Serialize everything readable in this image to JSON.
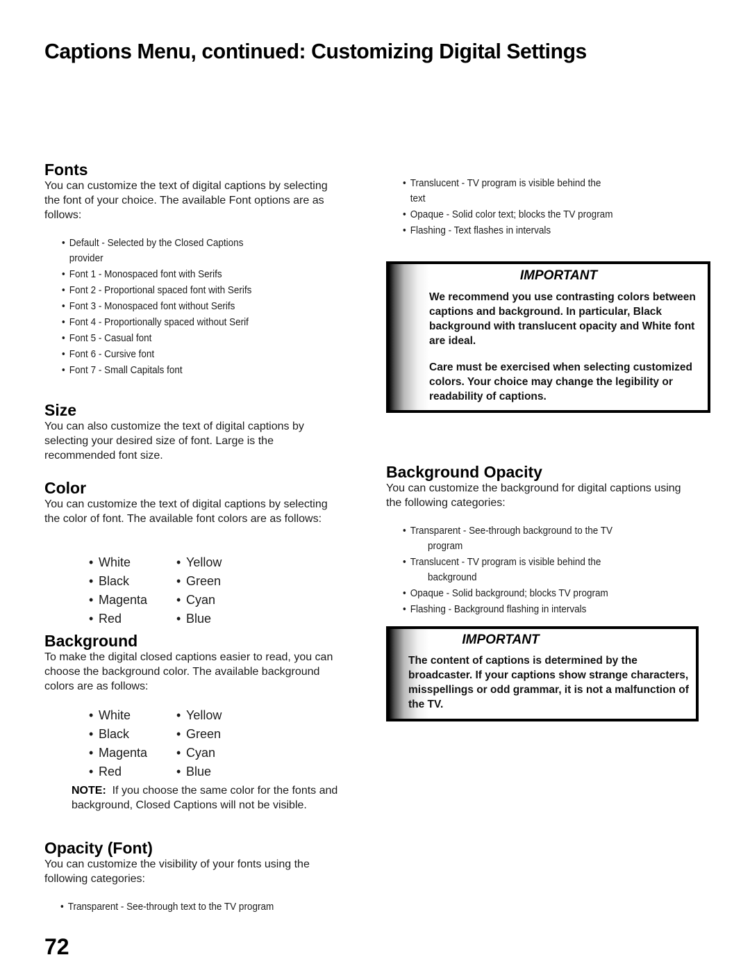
{
  "page": {
    "title": "Captions Menu, continued: Customizing Digital Settings",
    "page_number": "72"
  },
  "fonts": {
    "heading": "Fonts",
    "body": "You can customize the text of digital captions by selecting the font of your choice.  The available Font options are as follows:",
    "items": [
      {
        "text": "Default - Selected by the Closed Captions",
        "cont": "provider"
      },
      {
        "text": "Font 1 - Monospaced font with Serifs"
      },
      {
        "text": "Font 2 - Proportional spaced font with Serifs"
      },
      {
        "text": "Font 3 - Monospaced font without Serifs"
      },
      {
        "text": "Font 4 - Proportionally spaced without Serif"
      },
      {
        "text": "Font 5 - Casual font"
      },
      {
        "text": "Font 6 - Cursive font"
      },
      {
        "text": "Font 7 - Small Capitals font"
      }
    ]
  },
  "size": {
    "heading": "Size",
    "body": "You can also customize the text of digital captions by selecting your desired size of font.  Large is the recommended font size."
  },
  "color": {
    "heading": "Color",
    "body": "You can customize the text of digital captions by selecting the color of font.  The available font colors are as follows:",
    "options": [
      "White",
      "Yellow",
      "Black",
      "Green",
      "Magenta",
      "Cyan",
      "Red",
      "Blue"
    ]
  },
  "background": {
    "heading": "Background",
    "body": "To make the digital closed captions easier to read, you can choose the background color.  The available background colors are as follows:",
    "options": [
      "White",
      "Yellow",
      "Black",
      "Green",
      "Magenta",
      "Cyan",
      "Red",
      "Blue"
    ],
    "note_label": "NOTE:",
    "note_text": "If you choose the same color for the fonts and background, Closed Captions will not be visible."
  },
  "opacity_font": {
    "heading": "Opacity (Font)",
    "body": "You can customize the visibility of your fonts using the following categories:",
    "items": [
      {
        "text": "Transparent - See-through text to the TV program"
      },
      {
        "text": "Translucent - TV program is visible behind the",
        "cont": "text"
      },
      {
        "text": "Opaque - Solid color text; blocks the TV program"
      },
      {
        "text": "Flashing - Text flashes in intervals"
      }
    ]
  },
  "important_1": {
    "title": "IMPORTANT",
    "paragraphs": [
      "We recommend you use contrasting colors between captions and background.  In particular, Black background with translucent opacity and White font are ideal.",
      "Care must be exercised when selecting customized colors.  Your choice may change the legibility or readability of captions."
    ]
  },
  "background_opacity": {
    "heading": "Background Opacity",
    "body": "You can customize the background for digital captions using the following categories:",
    "items": [
      {
        "text": "Transparent - See-through background to the TV",
        "cont": "program"
      },
      {
        "text": "Translucent -  TV program is visible behind the",
        "cont": "background"
      },
      {
        "text": "Opaque - Solid background; blocks TV program"
      },
      {
        "text": "Flashing - Background flashing in intervals"
      }
    ]
  },
  "important_2": {
    "title": "IMPORTANT",
    "paragraphs": [
      "The content of captions is determined by the broadcaster.  If your captions show strange characters, misspellings or odd grammar, it is not a malfunction of the TV."
    ]
  }
}
